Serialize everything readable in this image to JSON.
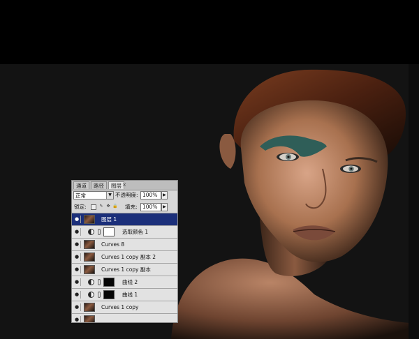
{
  "canvas": {
    "background_color": "#000000",
    "photo_background_color": "#131313"
  },
  "layers_panel": {
    "tabs": [
      {
        "label": "通道",
        "active": false
      },
      {
        "label": "路径",
        "active": false
      },
      {
        "label": "图层",
        "active": true
      }
    ],
    "blend_mode": "正常",
    "opacity_label": "不透明度:",
    "opacity_value": "100%",
    "lock_label": "锁定:",
    "fill_label": "填充:",
    "fill_value": "100%",
    "layers": [
      {
        "name": "图层 1",
        "selected": true,
        "type": "pixel",
        "thumb": "photo"
      },
      {
        "name": "选取颜色 1",
        "selected": false,
        "type": "adjustment",
        "thumb": "white"
      },
      {
        "name": "Curves 8",
        "selected": false,
        "type": "pixel",
        "thumb": "photo"
      },
      {
        "name": "Curves 1 copy 副本 2",
        "selected": false,
        "type": "pixel",
        "thumb": "photo"
      },
      {
        "name": "Curves 1 copy 副本",
        "selected": false,
        "type": "pixel",
        "thumb": "photo"
      },
      {
        "name": "曲线 2",
        "selected": false,
        "type": "adjustment",
        "thumb": "black"
      },
      {
        "name": "曲线 1",
        "selected": false,
        "type": "adjustment",
        "thumb": "black"
      },
      {
        "name": "Curves 1 copy",
        "selected": false,
        "type": "pixel",
        "thumb": "photo"
      }
    ]
  }
}
